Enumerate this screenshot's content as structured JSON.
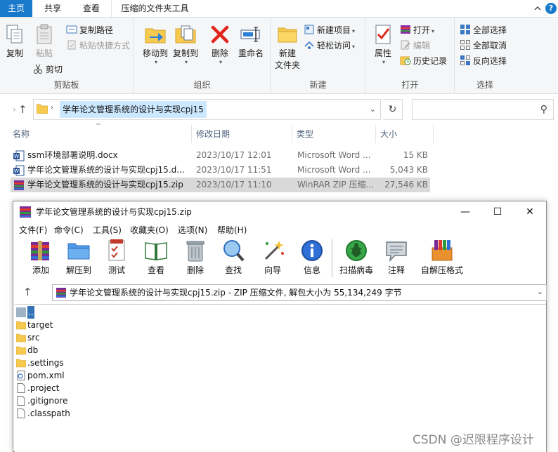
{
  "explorer": {
    "tabs": [
      {
        "label": "主页"
      },
      {
        "label": "共享"
      },
      {
        "label": "查看"
      },
      {
        "label": "压缩的文件夹工具"
      }
    ],
    "help_label": "?",
    "ribbon": {
      "clipboard": {
        "group_label": "剪贴板",
        "copy": "复制",
        "paste": "粘贴",
        "copy_path": "复制路径",
        "paste_shortcut": "粘贴快捷方式",
        "cut": "剪切"
      },
      "organize": {
        "group_label": "组织",
        "move_to": "移动到",
        "copy_to": "复制到",
        "delete": "删除",
        "rename": "重命名"
      },
      "new": {
        "group_label": "新建",
        "new_folder_line1": "新建",
        "new_folder_line2": "文件夹",
        "new_item": "新建项目",
        "easy_access": "轻松访问"
      },
      "open": {
        "group_label": "打开",
        "properties": "属性",
        "open": "打开",
        "edit": "编辑",
        "history": "历史记录"
      },
      "select": {
        "group_label": "选择",
        "select_all": "全部选择",
        "select_none": "全部取消",
        "invert": "反向选择"
      }
    },
    "address": {
      "path": "学年论文管理系统的设计与实现cpj15"
    },
    "columns": {
      "name": "名称",
      "date": "修改日期",
      "type": "类型",
      "size": "大小"
    },
    "files": [
      {
        "name": "ssm环境部署说明.docx",
        "date": "2023/10/17 12:01",
        "type": "Microsoft Word ...",
        "size": "15 KB",
        "icon": "word-doc-icon"
      },
      {
        "name": "学年论文管理系统的设计与实现cpj15.d...",
        "date": "2023/10/17 11:51",
        "type": "Microsoft Word ...",
        "size": "5,043 KB",
        "icon": "word-doc-icon"
      },
      {
        "name": "学年论文管理系统的设计与实现cpj15.zip",
        "date": "2023/10/17 11:10",
        "type": "WinRAR ZIP 压缩...",
        "size": "27,546 KB",
        "icon": "winrar-zip-icon"
      }
    ]
  },
  "winrar": {
    "title": "学年论文管理系统的设计与实现cpj15.zip",
    "menu": [
      "文件(F)",
      "命令(C)",
      "工具(S)",
      "收藏夹(O)",
      "选项(N)",
      "帮助(H)"
    ],
    "toolbar": [
      "添加",
      "解压到",
      "测试",
      "查看",
      "删除",
      "查找",
      "向导",
      "信息",
      "扫描病毒",
      "注释",
      "自解压格式"
    ],
    "path_text": "学年论文管理系统的设计与实现cpj15.zip - ZIP 压缩文件, 解包大小为 55,134,249 字节",
    "entries": [
      {
        "name": "..",
        "kind": "parent"
      },
      {
        "name": "target",
        "kind": "folder"
      },
      {
        "name": "src",
        "kind": "folder"
      },
      {
        "name": "db",
        "kind": "folder"
      },
      {
        "name": ".settings",
        "kind": "folder"
      },
      {
        "name": "pom.xml",
        "kind": "xml"
      },
      {
        "name": ".project",
        "kind": "file"
      },
      {
        "name": ".gitignore",
        "kind": "file"
      },
      {
        "name": ".classpath",
        "kind": "file"
      }
    ]
  },
  "watermark": "CSDN @迟限程序设计",
  "colors": {
    "accent": "#1979ca",
    "selection": "#cce8ff",
    "rar_highlight": "#3573b8"
  }
}
